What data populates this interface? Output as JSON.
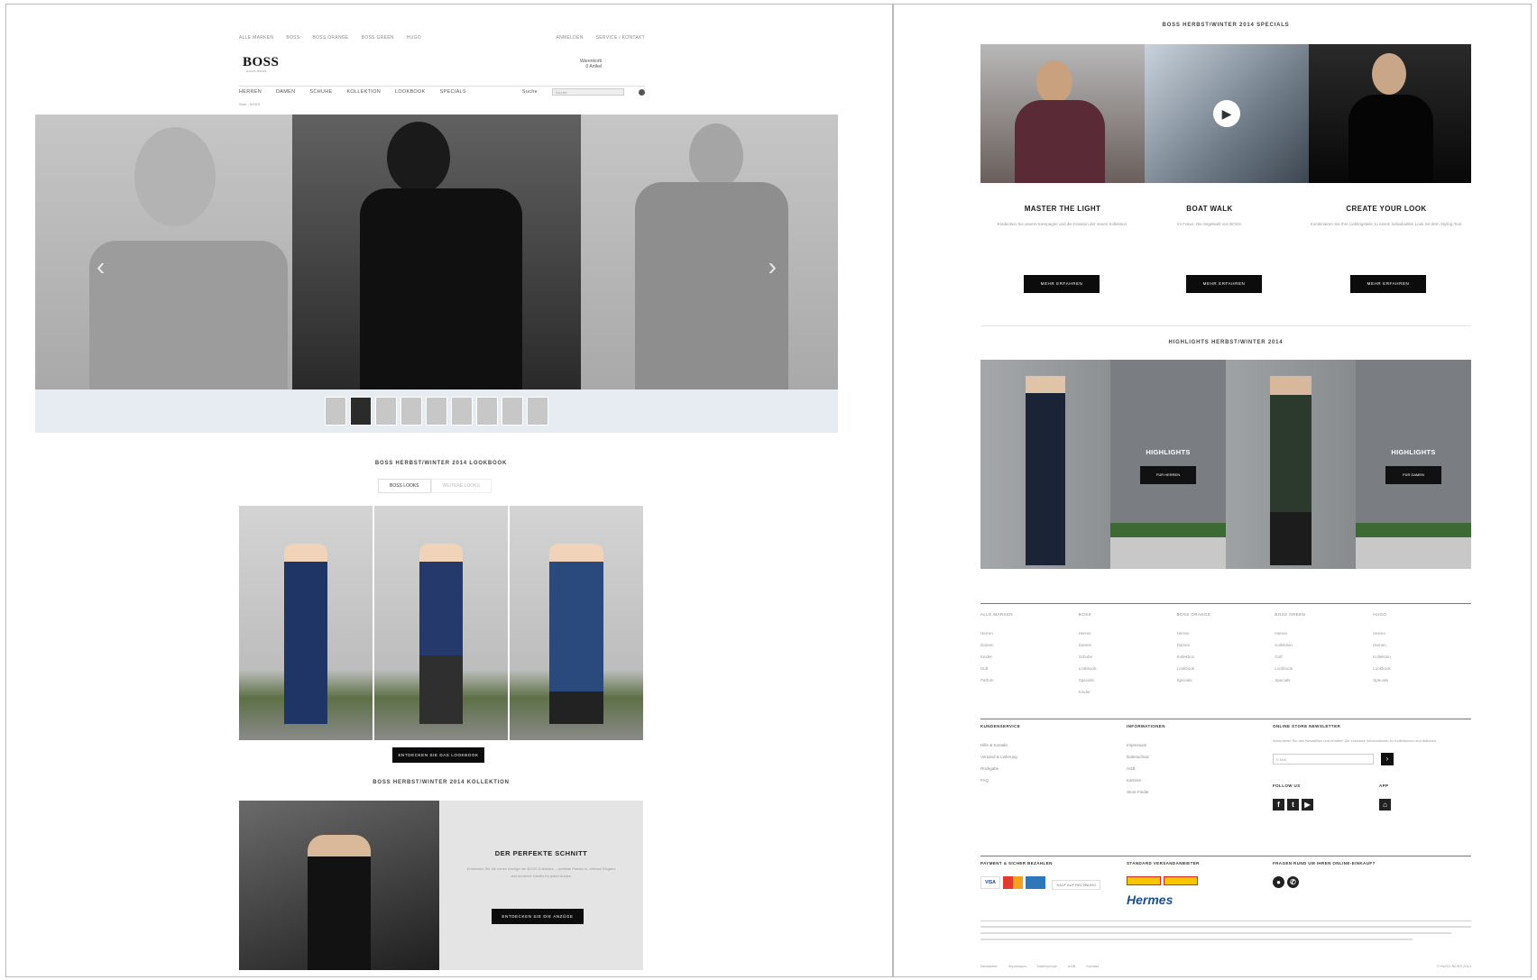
{
  "colors": {
    "accent": "#0c0c0c",
    "thumb_bar": "#e6ecf2",
    "text_muted": "#999999"
  },
  "left": {
    "utility_nav": [
      "ALLE MARKEN",
      "BOSS",
      "BOSS ORANGE",
      "BOSS GREEN",
      "HUGO"
    ],
    "utility_right": [
      "ANMELDEN",
      "SERVICE / KONTAKT"
    ],
    "logo": "BOSS",
    "logo_sub": "HUGO BOSS",
    "cart": [
      "Warenkorb",
      "0 Artikel"
    ],
    "main_nav": [
      "HERREN",
      "DAMEN",
      "SCHUHE",
      "KOLLEKTION",
      "LOOKBOOK",
      "SPECIALS"
    ],
    "search": {
      "label": "Suche",
      "placeholder": "Suche"
    },
    "breadcrumb": "Start · BOSS",
    "hero_thumbs": 9,
    "lookbook_title": "BOSS HERBST/WINTER 2014 LOOKBOOK",
    "lookbook_tabs": [
      "BOSS LOOKS",
      "WEITERE LOOKS"
    ],
    "lookbook_button": "ENTDECKEN SIE DAS LOOKBOOK",
    "collection_title": "BOSS HERBST/WINTER 2014 KOLLEKTION",
    "promo": {
      "heading": "DER PERFEKTE SCHNITT",
      "text": "Entdecken Sie die neuen Anzüge der BOSS Kollektion – perfekte Passform, zeitlose Eleganz und moderne Details für jeden Anlass.",
      "button": "ENTDECKEN SIE DIE ANZÜGE"
    }
  },
  "right": {
    "specials_title": "BOSS HERBST/WINTER 2014 SPECIALS",
    "specials": [
      {
        "heading": "MASTER THE LIGHT",
        "text": "Entdecken Sie unsere Kampagne und die Kreation der neuen Kollektion.",
        "button": "MEHR ERFAHREN"
      },
      {
        "heading": "BOAT WALK",
        "text": "Im Fokus: Die Segelwelt von BOSS.",
        "button": "MEHR ERFAHREN"
      },
      {
        "heading": "CREATE YOUR LOOK",
        "text": "Kombinieren Sie Ihre Lieblingsteile zu einem individuellen Look mit dem Styling-Tool.",
        "button": "MEHR ERFAHREN"
      }
    ],
    "highlights_title": "HIGHLIGHTS HERBST/WINTER 2014",
    "highlights": [
      {
        "label": "HIGHLIGHTS",
        "button": "FÜR HERREN"
      },
      {
        "label": "HIGHLIGHTS",
        "button": "FÜR DAMEN"
      }
    ],
    "footer_columns": [
      {
        "title": "ALLE MARKEN",
        "items": [
          "Herren",
          "Damen",
          "Kinder",
          "Duft",
          "Parfum"
        ]
      },
      {
        "title": "BOSS",
        "items": [
          "Herren",
          "Damen",
          "Schuhe",
          "Lookbook",
          "Specials",
          "Kinder"
        ]
      },
      {
        "title": "BOSS ORANGE",
        "items": [
          "Herren",
          "Damen",
          "Kollektion",
          "Lookbook",
          "Specials"
        ]
      },
      {
        "title": "BOSS GREEN",
        "items": [
          "Herren",
          "Kollektion",
          "Golf",
          "Lookbook",
          "Specials"
        ]
      },
      {
        "title": "HUGO",
        "items": [
          "Herren",
          "Damen",
          "Kollektion",
          "Lookbook",
          "Specials"
        ]
      }
    ],
    "service": {
      "title": "KUNDENSERVICE",
      "items": [
        "Hilfe & Kontakt",
        "Versand & Lieferung",
        "Rückgabe",
        "FAQ"
      ]
    },
    "info": {
      "title": "INFORMATIONEN",
      "items": [
        "Impressum",
        "Datenschutz",
        "AGB",
        "Karriere",
        "Store Finder"
      ]
    },
    "newsletter": {
      "title": "ONLINE STORE NEWSLETTER",
      "text": "Abonnieren Sie den Newsletter und erhalten Sie exklusive Informationen zu Kollektionen und Aktionen.",
      "placeholder": "E-Mail"
    },
    "follow_title": "FOLLOW US",
    "app_title": "APP",
    "payment_title": "PAYMENT & SICHER BEZAHLEN",
    "payment_note": "KAUF AUF RECHNUNG",
    "shipping_title": "STANDARD VERSANDANBIETER",
    "shipping_carrier": "Hermes",
    "contact_title": "FRAGEN RUND UM IHREN ONLINE-EINKAUF?",
    "bottom_links": [
      "Newsletter",
      "Impressum",
      "Datenschutz",
      "AGB",
      "Kontakt"
    ],
    "bottom_right": "© HUGO BOSS 2014"
  }
}
